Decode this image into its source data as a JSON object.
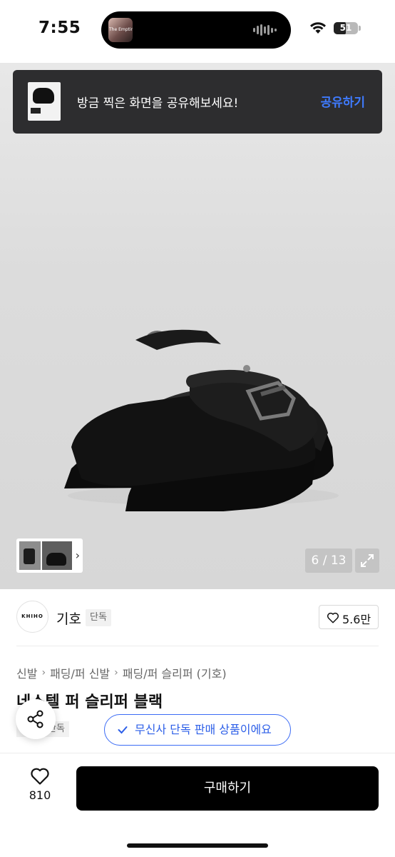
{
  "status_bar": {
    "time": "7:55",
    "battery": "51",
    "battery_level": 0.51
  },
  "toast": {
    "message": "방금 찍은 화면을 공유해보세요!",
    "action": "공유하기"
  },
  "gallery": {
    "counter": "6 / 13",
    "next_glyph": "›"
  },
  "brand": {
    "logo_text": "KHIHO",
    "name": "기호",
    "badge": "단독",
    "likes": "5.6만"
  },
  "breadcrumb": {
    "items": [
      "신발",
      "패딩/퍼 신발",
      "패딩/퍼 슬리퍼 (기호)"
    ],
    "separator": "›"
  },
  "product": {
    "title": "네스텔 퍼 슬리퍼 블랙",
    "tag": "단독",
    "exclusive_notice": "무신사 단독 판매 상품이에요"
  },
  "bottom_bar": {
    "wish_count": "810",
    "buy_label": "구매하기"
  },
  "colors": {
    "accent_blue": "#3c6cf5",
    "toast_bg": "#2d2d2f",
    "buy_bg": "#000000"
  },
  "icons": [
    "wifi-icon",
    "battery-icon",
    "chevron-right-icon",
    "expand-icon",
    "heart-icon",
    "share-icon",
    "check-icon"
  ]
}
